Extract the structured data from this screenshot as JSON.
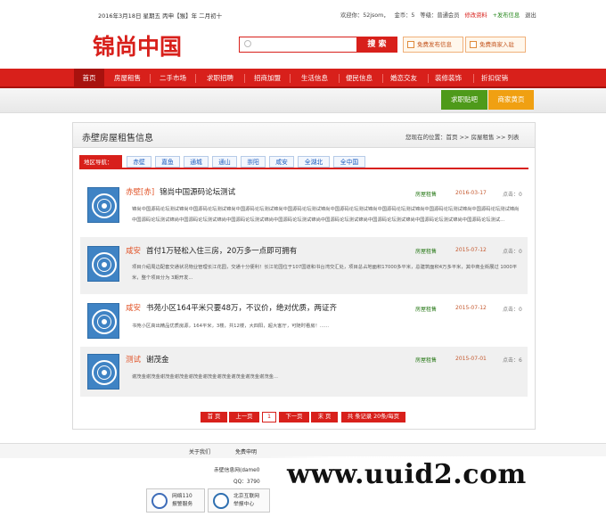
{
  "topbar": {
    "date": "2016年3月18日 星期五 丙申【猴】年 二月初十",
    "welcome": "欢迎你：52jsom，",
    "coins": "金币：5",
    "level": "等级：普通会员",
    "edit_profile": "修改资料",
    "publish": "+发布信息",
    "logout": "退出"
  },
  "logo": {
    "text": "锦尚中国"
  },
  "search": {
    "placeholder": "",
    "button": "搜 索"
  },
  "actions": {
    "free_post": "免费发布信息",
    "free_join": "免费商家入驻"
  },
  "nav": {
    "items": [
      "首页",
      "房屋租售",
      "二手市场",
      "求职招聘",
      "招商加盟",
      "生活信息",
      "便民信息",
      "婚恋交友",
      "装修装饰",
      "折扣促销"
    ]
  },
  "tags": {
    "jobs": "求职贴吧",
    "merchants": "商家黄页"
  },
  "panel": {
    "title": "赤壁房屋租售信息",
    "breadcrumb": "您现在的位置：首页 >> 房屋租售 >> 列表"
  },
  "region": {
    "label": "地区导航：",
    "links": [
      "赤壁",
      "嘉鱼",
      "通城",
      "通山",
      "崇阳",
      "咸安",
      "全湖北",
      "全中国"
    ]
  },
  "posts": [
    {
      "location": "赤壁[赤]",
      "title": "锦尚中国源码论坛测试",
      "category": "房屋租售",
      "date": "2016-03-17",
      "clicks": "点击：0",
      "desc": "锦尚中国源码论坛测试锦尚中国源码论坛测试锦尚中国源码论坛测试锦尚中国源码论坛测试锦尚中国源码论坛测试锦尚中国源码论坛测试锦尚中国源码论坛测试锦尚中国源码论坛测试锦尚中国源码论坛测试锦尚中国源码论坛测试锦尚中国源码论坛测试锦尚中国源码论坛测试锦尚中国源码论坛测试锦尚中国源码论坛测试锦尚中国源码论坛测试锦尚中国源码论坛测试..."
    },
    {
      "location": "咸安",
      "title": "首付1万轻松入住三房，20万多一点即可拥有",
      "category": "房屋租售",
      "date": "2015-07-12",
      "clicks": "点击：0",
      "desc": "项目介绍周边配套交通状况物业管理长江花园，交通十分便利！长江花园位于107国道和书台湾交汇处，项目总占地面积17000多平米，总建筑面积4万多平米，其中商业街展过 1000平米，整个项目分为 3期开发..."
    },
    {
      "location": "咸安",
      "title": "书苑小区164平米只要48万，不议价，绝对优质，两证齐",
      "category": "房屋租售",
      "date": "2015-07-12",
      "clicks": "点击：0",
      "desc": "书苑小区高出精品优质房源，164平米，3楼，共12楼，大四阳，超大客厅，可随时看房！......"
    },
    {
      "location": "测试",
      "title": "谢茂金",
      "category": "房屋租售",
      "date": "2015-07-01",
      "clicks": "点击：6",
      "desc": "谢茂金谢茂金谢茂金谢茂金谢茂金谢茂金谢茂金谢茂金谢茂金谢茂金..."
    }
  ],
  "pager": {
    "first": "首 页",
    "prev": "上一页",
    "current": "1",
    "next": "下一页",
    "last": "末 页",
    "total": "共 条记录 20条/每页"
  },
  "footer": {
    "links": [
      "关于我们",
      "免费申明"
    ],
    "company": "赤壁信息网(dame0",
    "qq": "QQ：3790",
    "badge1": "网络110\n报警服务",
    "badge2": "北京互联网\n举报中心"
  },
  "watermark": "www.uuid2.com",
  "colors": {
    "brand_red": "#d8201b",
    "dark_red": "#a8120e",
    "green": "#4e9a1a",
    "orange": "#f0a012",
    "link_blue": "#1b5cbf"
  }
}
